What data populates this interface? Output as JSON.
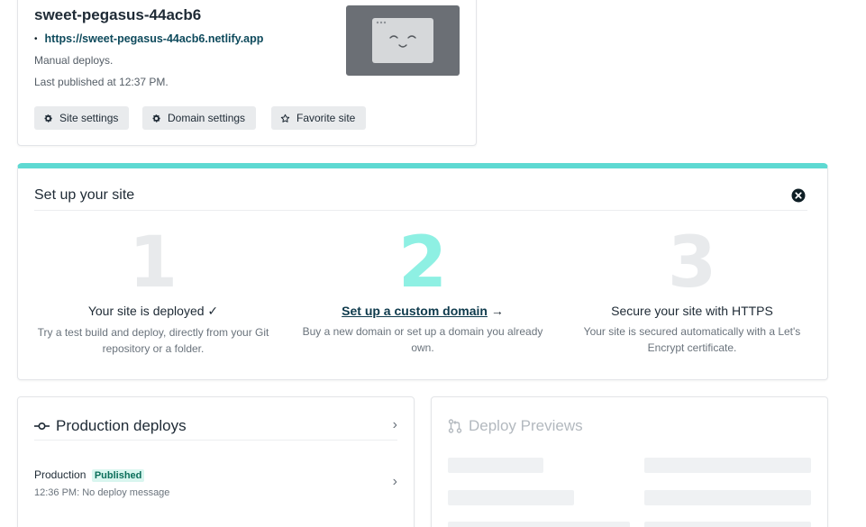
{
  "site": {
    "name": "sweet-pegasus-44acb6",
    "url": "https://sweet-pegasus-44acb6.netlify.app",
    "deploy_mode": "Manual deploys.",
    "last_published": "Last published at 12:37 PM.",
    "buttons": {
      "site_settings": "Site settings",
      "domain_settings": "Domain settings",
      "favorite_site": "Favorite site"
    }
  },
  "setup": {
    "title": "Set up your site",
    "steps": [
      {
        "number": "1",
        "heading": "Your site is deployed ✓",
        "description": "Try a test build and deploy, directly from your Git repository or a folder."
      },
      {
        "number": "2",
        "heading": "Set up a custom domain",
        "arrow": "→",
        "description": "Buy a new domain or set up a domain you already own."
      },
      {
        "number": "3",
        "heading": "Secure your site with HTTPS",
        "description": "Your site is secured automatically with a Let's Encrypt certificate."
      }
    ]
  },
  "production_deploys": {
    "title": "Production deploys",
    "chevron": "›",
    "row": {
      "label": "Production",
      "badge": "Published",
      "message": "12:36 PM: No deploy message",
      "chevron": "›"
    }
  },
  "deploy_previews": {
    "title": "Deploy Previews"
  },
  "colors": {
    "accent_teal": "#5ed9d2",
    "step_active": "#8ef0e3",
    "badge_bg": "#d9f6ef",
    "badge_text": "#0b6e5a"
  },
  "icons": [
    "gear-icon",
    "star-outline-icon",
    "close-circle-icon",
    "commit-icon",
    "pull-request-icon",
    "browser-smiley-icon"
  ]
}
